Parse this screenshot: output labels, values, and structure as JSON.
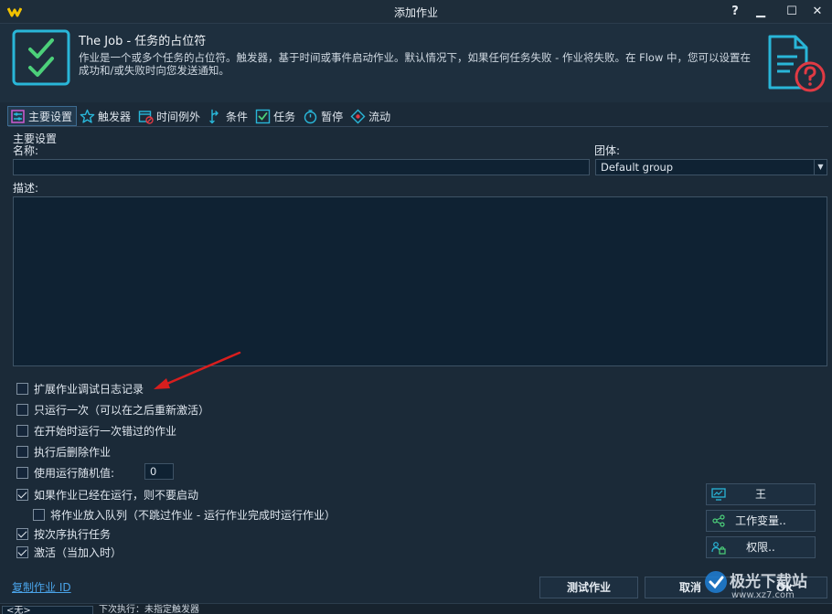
{
  "window": {
    "title": "添加作业",
    "help": "?",
    "minimize": "▁",
    "maximize": "☐",
    "close": "✕"
  },
  "header": {
    "title": "The Job - 任务的占位符",
    "description": "作业是一个或多个任务的占位符。触发器，基于时间或事件启动作业。默认情况下，如果任何任务失败 - 作业将失败。在 Flow 中，您可以设置在成功和/或失败时向您发送通知。"
  },
  "tabs": [
    {
      "label": "主要设置",
      "icon": "settings-icon"
    },
    {
      "label": "触发器",
      "icon": "star-icon"
    },
    {
      "label": "时间例外",
      "icon": "calendar-icon"
    },
    {
      "label": "条件",
      "icon": "branch-icon"
    },
    {
      "label": "任务",
      "icon": "check-icon"
    },
    {
      "label": "暂停",
      "icon": "stopwatch-icon"
    },
    {
      "label": "流动",
      "icon": "flow-icon"
    }
  ],
  "main": {
    "section_title": "主要设置",
    "name_label": "名称:",
    "name_value": "",
    "group_label": "团体:",
    "group_value": "Default group",
    "desc_label": "描述:",
    "desc_value": ""
  },
  "options": {
    "extended_log": {
      "label": "扩展作业调试日志记录",
      "checked": false
    },
    "run_once": {
      "label": "只运行一次（可以在之后重新激活）",
      "checked": false
    },
    "run_missed": {
      "label": "在开始时运行一次错过的作业",
      "checked": false
    },
    "delete_after": {
      "label": "执行后删除作业",
      "checked": false
    },
    "random_value": {
      "label": "使用运行随机值:",
      "checked": false,
      "value": "0"
    },
    "dont_start_if_running": {
      "label": "如果作业已经在运行，则不要启动",
      "checked": true
    },
    "queue_job": {
      "label": "将作业放入队列（不跳过作业 - 运行作业完成时运行作业）",
      "checked": false
    },
    "sequential": {
      "label": "按次序执行任务",
      "checked": true
    },
    "active": {
      "label": "激活（当加入时）",
      "checked": true
    }
  },
  "side_buttons": {
    "monitor": "王",
    "variables": "工作变量..",
    "permissions": "权限.."
  },
  "footer": {
    "copy_id": "复制作业 ID",
    "test": "测试作业",
    "cancel": "取消",
    "ok": "Ok"
  },
  "statusbar": {
    "field": "<无>",
    "text": "下次执行：未指定触发器"
  },
  "watermark": {
    "text": "极光下载站",
    "url": "www.xz7.com"
  },
  "colors": {
    "accent": "#29b6d8",
    "danger": "#e03a44",
    "arrow": "#d81e1e",
    "link": "#4aa3e8"
  }
}
